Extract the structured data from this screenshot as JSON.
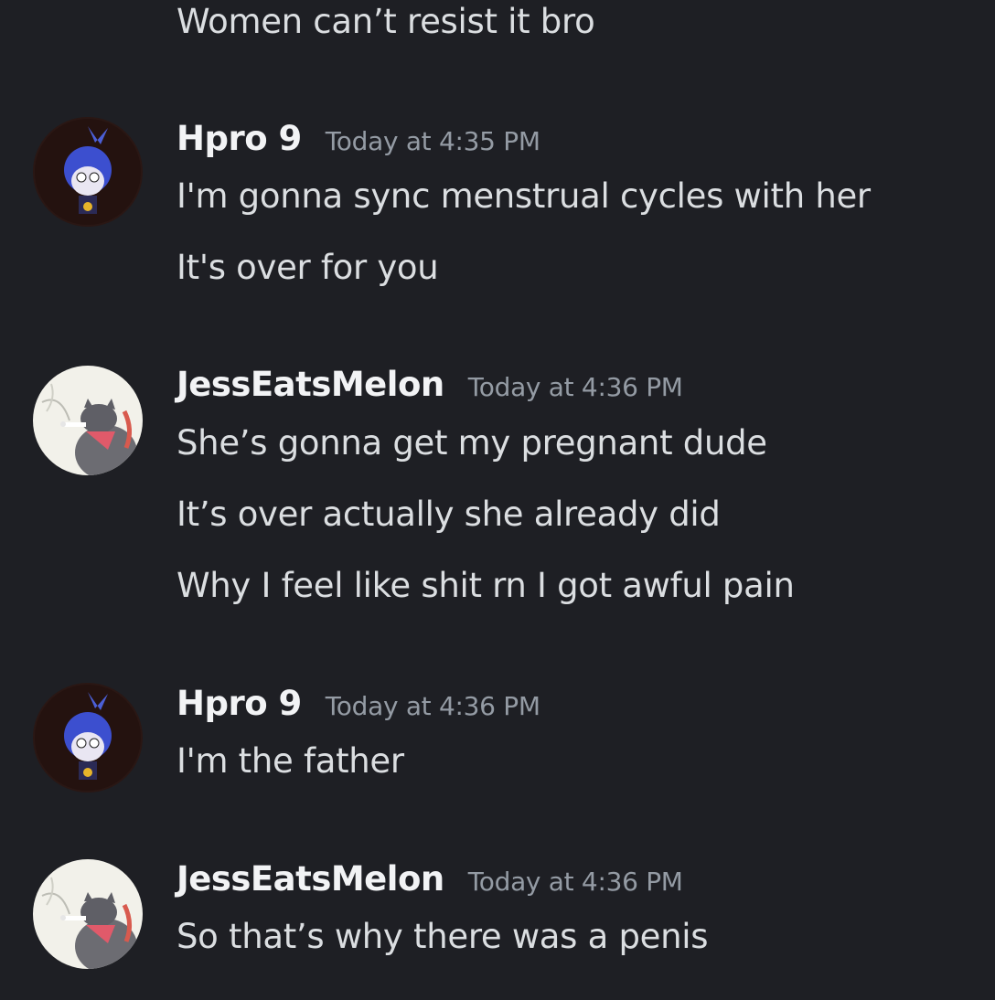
{
  "messages": [
    {
      "continuation": true,
      "lines": [
        "Women can’t resist it bro"
      ]
    },
    {
      "author": "Hpro 9",
      "timestamp": "Today at 4:35 PM",
      "avatar": "blue-haired-character-avatar",
      "lines": [
        "I'm gonna sync menstrual cycles with her",
        "It's over for you"
      ]
    },
    {
      "author": "JessEatsMelon",
      "timestamp": "Today at 4:36 PM",
      "avatar": "cat-smoking-avatar",
      "lines": [
        "She’s gonna get my pregnant dude",
        "It’s over actually she already did",
        "Why I feel like shit rn I got awful pain"
      ]
    },
    {
      "author": "Hpro 9",
      "timestamp": "Today at 4:36 PM",
      "avatar": "blue-haired-character-avatar",
      "lines": [
        "I'm the father"
      ]
    },
    {
      "author": "JessEatsMelon",
      "timestamp": "Today at 4:36 PM",
      "avatar": "cat-smoking-avatar",
      "lines": [
        "So that’s why there was a penis"
      ]
    }
  ],
  "colors": {
    "background": "#1e1f24",
    "username": "#f2f3f5",
    "timestamp": "#949ba4",
    "message_text": "#dbdee1"
  }
}
